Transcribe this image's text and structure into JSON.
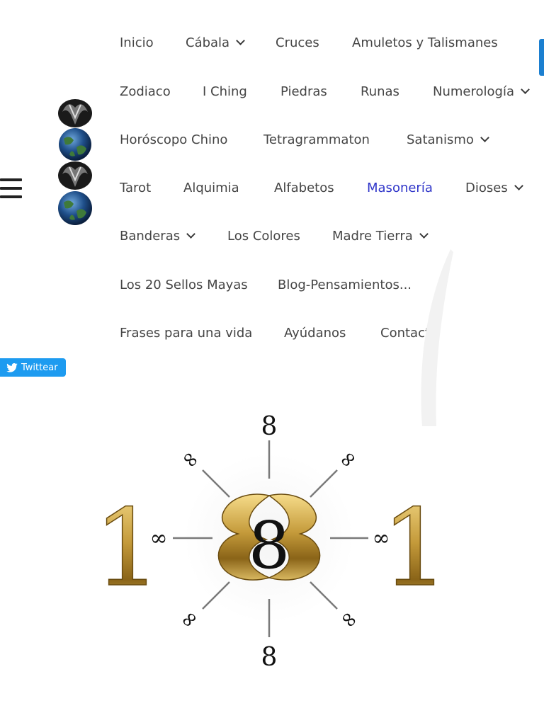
{
  "navigation": {
    "items": [
      {
        "label": "Inicio"
      },
      {
        "label": "Cábala"
      },
      {
        "label": "Cruces"
      },
      {
        "label": "Amuletos y Talismanes"
      },
      {
        "label": "Zodiaco"
      },
      {
        "label": "I Ching"
      },
      {
        "label": "Piedras"
      },
      {
        "label": "Runas"
      },
      {
        "label": "Numerología"
      },
      {
        "label": "Horóscopo Chino"
      },
      {
        "label": "Tetragrammaton"
      },
      {
        "label": "Satanismo"
      },
      {
        "label": "Tarot"
      },
      {
        "label": "Alquimia"
      },
      {
        "label": "Alfabetos"
      },
      {
        "label": "Masonería"
      },
      {
        "label": "Dioses"
      },
      {
        "label": "Banderas"
      },
      {
        "label": "Los Colores"
      },
      {
        "label": "Madre Tierra"
      },
      {
        "label": "Los 20 Sellos Mayas"
      },
      {
        "label": "Blog-Pensamientos..."
      },
      {
        "label": "Frases para una vida"
      },
      {
        "label": "Ayúdanos"
      },
      {
        "label": "Contacto"
      }
    ],
    "active_color": "#2f35c9"
  },
  "share": {
    "tweet_label": "Twittear",
    "icon": "twitter-bird-icon",
    "color": "#1d9bf0"
  },
  "emblem": {
    "top": "8",
    "bottom": "8",
    "center": "8",
    "left": "1",
    "right": "1",
    "infinity": "∞",
    "diag_top_left": "∞",
    "diag_top_right": "∞",
    "diag_bottom_left": "∞",
    "diag_bottom_right": "∞"
  },
  "icons": {
    "menu": "hamburger-menu-icon",
    "logo": "site-logo-stacked-globes"
  }
}
